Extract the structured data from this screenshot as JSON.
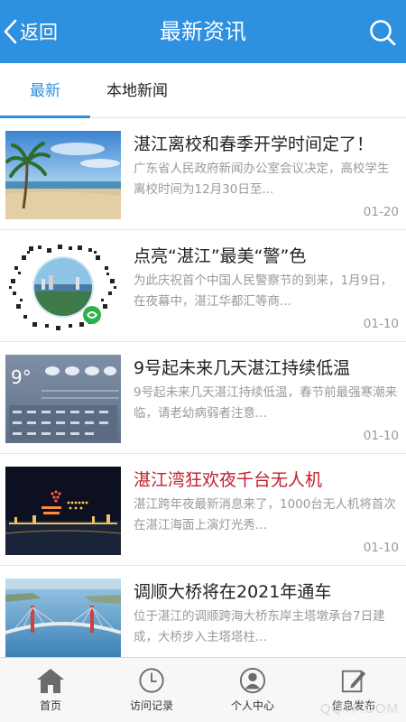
{
  "header": {
    "back_label": "返回",
    "title": "最新资讯",
    "accent_color": "#2e90e0"
  },
  "tabs": [
    {
      "label": "最新",
      "active": true
    },
    {
      "label": "本地新闻",
      "active": false
    }
  ],
  "news": [
    {
      "title": "湛江离校和春季开学时间定了！",
      "desc": "广东省人民政府新闻办公室会议决定，高校学生离校时间为12月30日至...",
      "date": "01-20",
      "thumb": "beach-palm-image",
      "highlight": false
    },
    {
      "title": "点亮“湛江”最美“警”色",
      "desc": "为此庆祝首个中国人民警察节的到来，1月9日，在夜幕中，湛江华都汇等商...",
      "date": "01-10",
      "thumb": "wechat-qr-code-image",
      "highlight": false
    },
    {
      "title": "9号起未来几天湛江持续低温",
      "desc": "9号起未来几天湛江持续低温，春节前最强寒潮来临，请老幼病弱者注意...",
      "date": "01-10",
      "thumb": "weather-forecast-image",
      "highlight": false
    },
    {
      "title": "湛江湾狂欢夜千台无人机",
      "desc": "湛江跨年夜最新消息来了，1000台无人机将首次在湛江海面上演灯光秀...",
      "date": "01-10",
      "thumb": "drone-show-night-image",
      "highlight": true
    },
    {
      "title": "调顺大桥将在2021年通车",
      "desc": "位于湛江的调顺跨海大桥东岸主塔墩承台7日建成，大桥步入主塔塔柱...",
      "date": "",
      "thumb": "sea-bridge-image",
      "highlight": false
    }
  ],
  "bottom_nav": [
    {
      "label": "首页",
      "icon": "home-icon",
      "active": true
    },
    {
      "label": "访问记录",
      "icon": "clock-icon",
      "active": false
    },
    {
      "label": "个人中心",
      "icon": "user-icon",
      "active": false
    },
    {
      "label": "信息发布",
      "icon": "edit-icon",
      "active": false
    }
  ],
  "watermark": "QQTF.COM"
}
